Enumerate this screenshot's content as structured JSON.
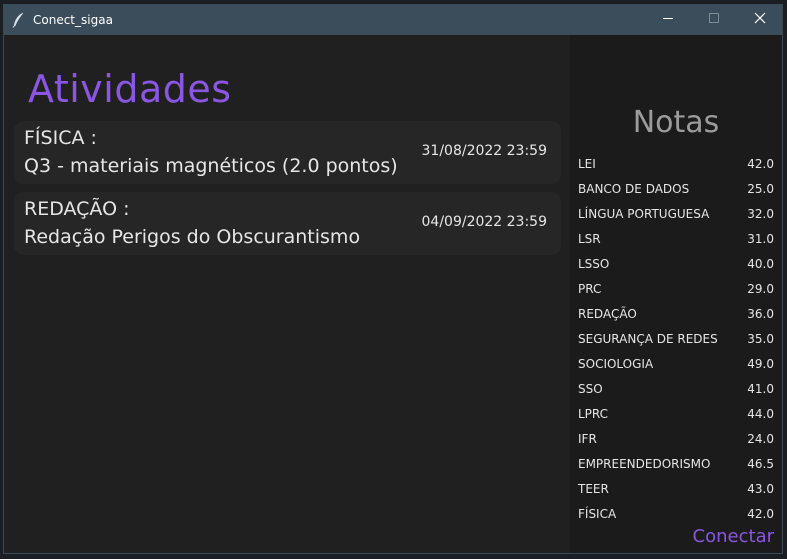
{
  "window": {
    "title": "Conect_sigaa"
  },
  "activities": {
    "heading": "Atividades",
    "items": [
      {
        "subject": "FÍSICA :",
        "task": "Q3 - materiais magnéticos (2.0 pontos)",
        "due": "31/08/2022 23:59"
      },
      {
        "subject": "REDAÇÃO :",
        "task": "Redação Perigos do Obscurantismo",
        "due": "04/09/2022 23:59"
      }
    ]
  },
  "grades": {
    "heading": "Notas",
    "rows": [
      {
        "name": "LEI",
        "value": "42.0"
      },
      {
        "name": "BANCO DE DADOS",
        "value": "25.0"
      },
      {
        "name": "LÍNGUA PORTUGUESA",
        "value": "32.0"
      },
      {
        "name": "LSR",
        "value": "31.0"
      },
      {
        "name": "LSSO",
        "value": "40.0"
      },
      {
        "name": "PRC",
        "value": "29.0"
      },
      {
        "name": "REDAÇÃO",
        "value": "36.0"
      },
      {
        "name": "SEGURANÇA DE REDES",
        "value": "35.0"
      },
      {
        "name": "SOCIOLOGIA",
        "value": "49.0"
      },
      {
        "name": "SSO",
        "value": "41.0"
      },
      {
        "name": "LPRC",
        "value": "44.0"
      },
      {
        "name": "IFR",
        "value": "24.0"
      },
      {
        "name": "EMPREENDEDORISMO",
        "value": "46.5"
      },
      {
        "name": "TEER",
        "value": "43.0"
      },
      {
        "name": "FÍSICA",
        "value": "42.0"
      }
    ],
    "connect_label": "Conectar"
  },
  "colors": {
    "accent": "#8a56e2",
    "titlebar": "#3b4d5a",
    "panel": "#202020",
    "card": "#262626"
  },
  "icons": {
    "app": "feather-icon",
    "minimize": "minimize-icon",
    "maximize": "maximize-icon",
    "close": "close-icon"
  }
}
